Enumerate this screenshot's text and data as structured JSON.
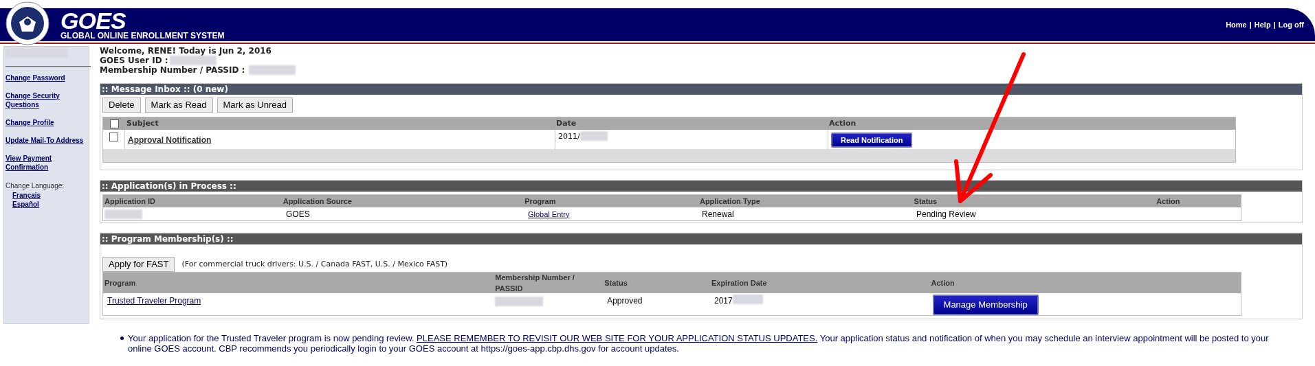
{
  "header": {
    "logo": "GOES",
    "subtitle": "GLOBAL ONLINE ENROLLMENT SYSTEM",
    "nav_links": [
      "Home",
      "Help",
      "Log off"
    ],
    "separator": "|"
  },
  "sidebar": {
    "links": [
      "Change Password",
      "Change Security Questions",
      "Change Profile",
      "Update Mail-To Address",
      "View Payment Confirmation"
    ],
    "language_label": "Change Language:",
    "languages": [
      "Français",
      "Español"
    ]
  },
  "welcome": {
    "greeting": "Welcome, RENE! Today is Jun 2, 2016",
    "user_id_label": "GOES User ID :",
    "membership_label": "Membership Number / PASSID :"
  },
  "inbox": {
    "title": ":: Message Inbox :: (0 new)",
    "buttons": [
      "Delete",
      "Mark as Read",
      "Mark as Unread"
    ],
    "select_all_checked": false,
    "columns": [
      "Subject",
      "Date",
      "Action"
    ],
    "rows": [
      {
        "checked": false,
        "subject": "Approval Notification",
        "date": "2011/",
        "action": "Read Notification"
      }
    ]
  },
  "applications": {
    "title": ":: Application(s) in Process ::",
    "columns": [
      "Application ID",
      "Application Source",
      "Program",
      "Application Type",
      "Status",
      "Action"
    ],
    "rows": [
      {
        "source": "GOES",
        "program": "Global Entry",
        "type": "Renewal",
        "status": "Pending Review"
      }
    ]
  },
  "memberships": {
    "title": ":: Program Membership(s) ::",
    "apply_button": "Apply for FAST",
    "note": "(For commercial truck drivers: U.S. / Canada FAST, U.S. / Mexico FAST)",
    "columns": [
      "Program",
      "Membership Number / PASSID",
      "Status",
      "Expiration Date",
      "Action"
    ],
    "rows": [
      {
        "program": "Trusted Traveler Program",
        "status": "Approved",
        "expiration": "2017",
        "action": "Manage Membership"
      }
    ]
  },
  "notice": {
    "text": "Your application for the Trusted Traveler program is now pending review.",
    "link": "PLEASE REMEMBER TO REVISIT OUR WEB SITE FOR YOUR APPLICATION STATUS UPDATES.",
    "rest": "Your application status and notification of when you may schedule an interview appointment will be posted to your online GOES account. CBP recommends you periodically login to your GOES account at https://goes-app.cbp.dhs.gov for account updates."
  }
}
